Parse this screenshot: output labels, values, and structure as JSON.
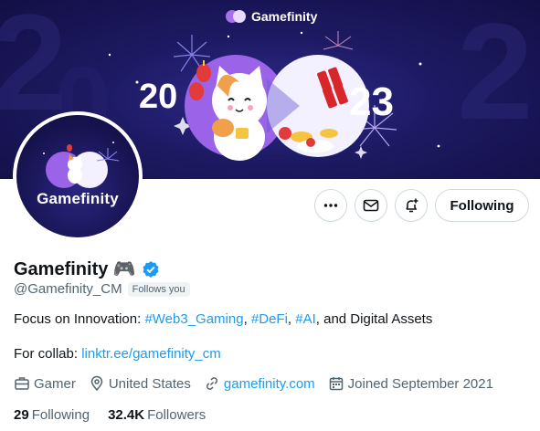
{
  "banner": {
    "brand_name": "Gamefinity",
    "year_left": "20",
    "year_right": "23",
    "bg_year_left": "2",
    "bg_year_right": "2"
  },
  "avatar": {
    "label": "Gamefinity"
  },
  "actions": {
    "follow_label": "Following"
  },
  "profile": {
    "display_name": "Gamefinity",
    "name_emoji": "🎮",
    "handle": "@Gamefinity_CM",
    "follows_you": "Follows you",
    "bio_prefix": "Focus on Innovation: ",
    "bio_tags": [
      "#Web3_Gaming",
      "#DeFi",
      "#AI"
    ],
    "bio_sep": ", ",
    "bio_suffix": ", and Digital Assets",
    "collab_label": "For collab: ",
    "collab_link": "linktr.ee/gamefinity_cm"
  },
  "meta": {
    "category": "Gamer",
    "location": "United States",
    "website": "gamefinity.com",
    "joined": "Joined September 2021"
  },
  "stats": {
    "following_count": "29",
    "following_label": "Following",
    "followers_count": "32.4K",
    "followers_label": "Followers"
  },
  "colors": {
    "link": "#1d9bf0",
    "verified": "#1d9bf0",
    "banner_bg": "#1d1a63",
    "brand_purple": "#a770ef"
  },
  "icons": [
    "more-icon",
    "message-icon",
    "notification-add-icon",
    "verified-badge-icon",
    "briefcase-icon",
    "location-icon",
    "link-icon",
    "calendar-icon"
  ]
}
